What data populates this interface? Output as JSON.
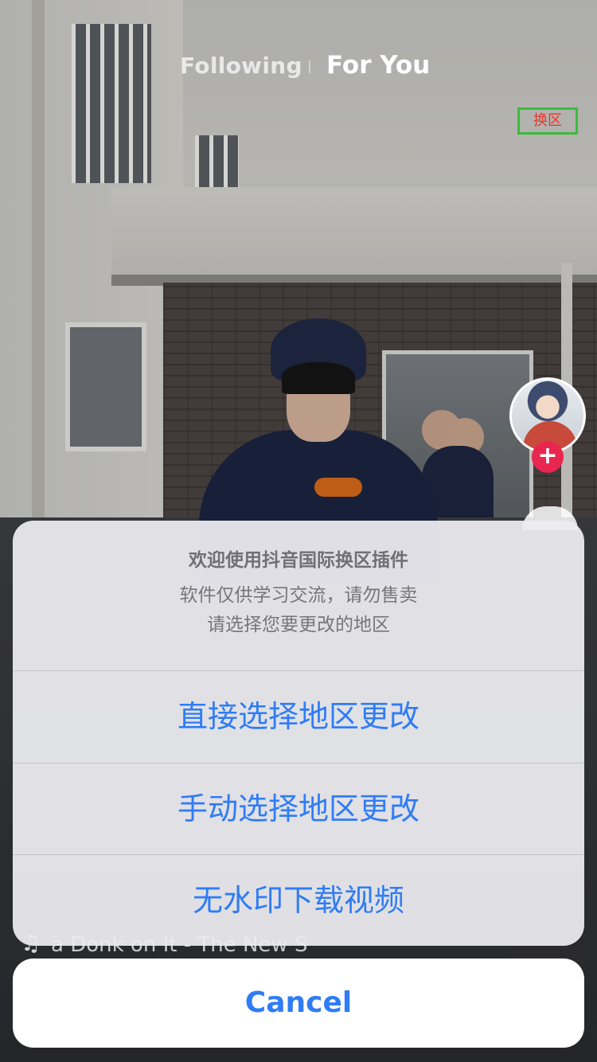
{
  "nav": {
    "following_label": "Following",
    "for_you_label": "For You",
    "region_button_label": "换区"
  },
  "music": {
    "icon": "music-note-icon",
    "text": "a Donk on It - The New S"
  },
  "sheet": {
    "title": "欢迎使用抖音国际换区插件",
    "message_line1": "软件仅供学习交流，请勿售卖",
    "message_line2": "请选择您要更改的地区",
    "options": [
      {
        "label": "直接选择地区更改"
      },
      {
        "label": "手动选择地区更改"
      },
      {
        "label": "无水印下载视频"
      }
    ],
    "cancel_label": "Cancel"
  },
  "colors": {
    "accent_blue": "#2f7cf6",
    "region_text_red": "#e8372b",
    "region_border_green": "#3cbb3c",
    "follow_plus_red": "#e8264f"
  }
}
